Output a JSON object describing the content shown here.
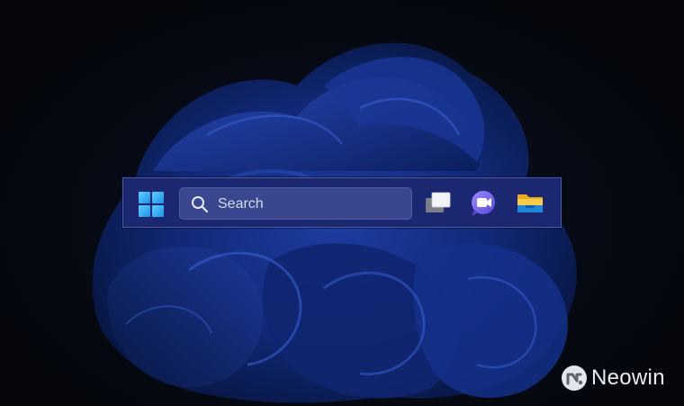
{
  "taskbar": {
    "search": {
      "label": "Search"
    },
    "buttons": [
      {
        "name": "start",
        "icon": "windows-logo-icon"
      },
      {
        "name": "task-view",
        "icon": "task-view-icon"
      },
      {
        "name": "chat",
        "icon": "teams-chat-icon"
      },
      {
        "name": "file-explorer",
        "icon": "folder-icon"
      }
    ]
  },
  "watermark": {
    "brand": "Neowin"
  },
  "colors": {
    "taskbar_bg": "#1b2770",
    "search_bg": "#3a4790",
    "start_blue": "#31a8f0",
    "chat_purple": "#7b6ae8",
    "folder_yellow": "#f6c33b",
    "folder_blue": "#1f88d9"
  }
}
